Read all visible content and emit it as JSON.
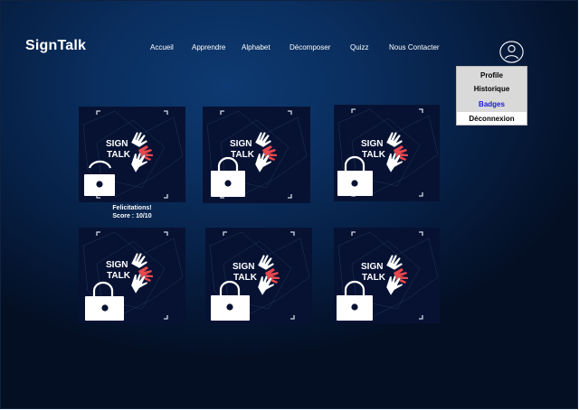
{
  "app": {
    "name": "SignTalk"
  },
  "nav": {
    "items": [
      {
        "label": "Accueil"
      },
      {
        "label": "Apprendre"
      },
      {
        "label": "Alphabet"
      },
      {
        "label": "Décomposer"
      },
      {
        "label": "Quizz"
      },
      {
        "label": "Nous Contacter"
      }
    ]
  },
  "user_menu": {
    "items": [
      {
        "label": "Profile"
      },
      {
        "label": "Historique"
      },
      {
        "label": "Badges"
      },
      {
        "label": "Déconnexion"
      }
    ],
    "active": "Badges"
  },
  "badges": [
    {
      "logo_text": [
        "SIGN",
        "TALK"
      ],
      "locked": false,
      "caption": [
        "Felicitations!",
        "Score : 10/10"
      ]
    },
    {
      "logo_text": [
        "SIGN",
        "TALK"
      ],
      "locked": true
    },
    {
      "logo_text": [
        "SIGN",
        "TALK"
      ],
      "locked": true
    },
    {
      "logo_text": [
        "SIGN",
        "TALK"
      ],
      "locked": true
    },
    {
      "logo_text": [
        "SIGN",
        "TALK"
      ],
      "locked": true
    },
    {
      "logo_text": [
        "SIGN",
        "TALK"
      ],
      "locked": true
    }
  ],
  "colors": {
    "background": "#0a2e5e",
    "hand_white": "#ffffff",
    "hand_red": "#e8474d",
    "active_menu": "#1b1bd6"
  }
}
